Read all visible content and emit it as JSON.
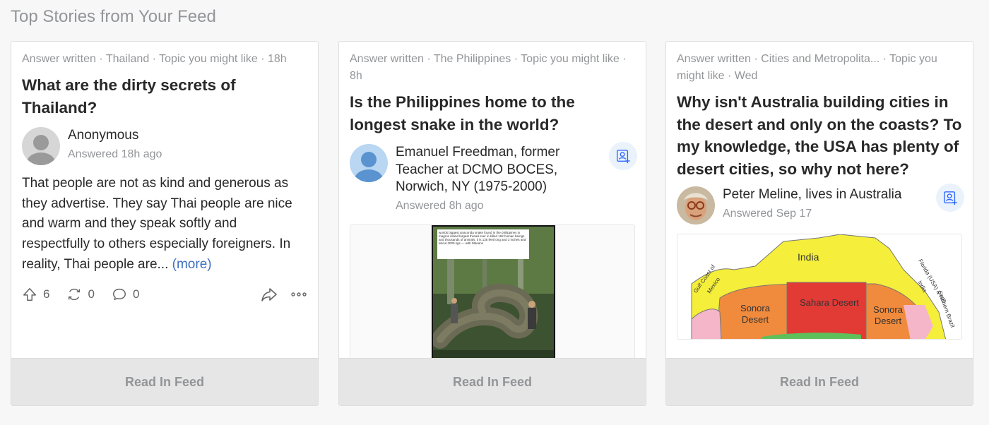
{
  "section_title": "Top Stories from Your Feed",
  "cards": [
    {
      "meta": "Answer written · Thailand · Topic you might like · 18h",
      "question": "What are the dirty secrets of Thailand?",
      "author_name": "Anonymous",
      "answered": "Answered 18h ago",
      "answer": "That people are not as kind and generous as they advertise. They say Thai people are nice and warm and they speak softly and respectfully to others especially foreigners. In reality, Thai people are...",
      "more": "(more)",
      "upvotes": "6",
      "shares": "0",
      "comments": "0",
      "read_label": "Read In Feed"
    },
    {
      "meta": "Answer written · The Philippines · Topic you might like · 8h",
      "question": "Is the Philippines home to the longest snake in the world?",
      "author_name": "Emanuel Freedman, former Teacher at DCMO BOCES, Norwich, NY (1975-2000)",
      "answered": "Answered 8h ago",
      "image_caption": "worlds biggest anaconda snake found in the philippines in magros island largest thread ever in killed 162 human beings and thousands of animals. it is 135 feet long and 3 inches and about 3000 kgs — with Mbeans",
      "read_label": "Read In Feed"
    },
    {
      "meta": "Answer written · Cities and Metropolita... · Topic you might like · Wed",
      "question": "Why isn't Australia building cities in the desert and only on the coasts? To my knowledge, the USA has plenty of desert cities, so why not here?",
      "author_name": "Peter Meline, lives in Australia",
      "answered": "Answered Sep 17",
      "map": {
        "india": "India",
        "gulf": "Gulf Coast of Mexico",
        "florida": "Florida (USA) & NE India",
        "sonora_left": "Sonora Desert",
        "sahara": "Sahara Desert",
        "sonora_right": "Sonora Desert",
        "southern": "Southern Brazil"
      },
      "read_label": "Read In Feed"
    }
  ]
}
